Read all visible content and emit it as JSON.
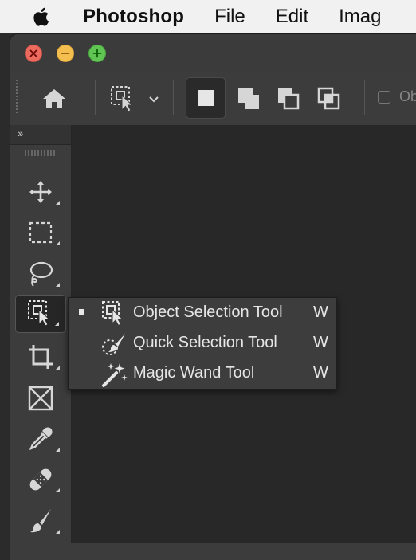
{
  "menubar": {
    "apple": "apple-icon",
    "app_name": "Photoshop",
    "items": [
      "File",
      "Edit",
      "Imag"
    ]
  },
  "window_controls": {
    "close_color": "#ed6a5e",
    "minimize_color": "#f5bf4f",
    "maximize_color": "#61c554"
  },
  "options_bar": {
    "home_icon": "home-icon",
    "tool_preset_icon": "object-selection-icon",
    "selection_modes": [
      "new-selection",
      "add-to-selection",
      "subtract-from-selection",
      "intersect-with-selection"
    ],
    "active_mode": "new-selection",
    "checkbox_label": "Ob"
  },
  "toolbar": {
    "collapse_label": "››",
    "tools": [
      {
        "name": "move-tool",
        "icon": "move-icon"
      },
      {
        "name": "rectangular-marquee-tool",
        "icon": "marquee-icon"
      },
      {
        "name": "lasso-tool",
        "icon": "lasso-icon"
      },
      {
        "name": "object-selection-tool",
        "icon": "object-selection-icon",
        "active": true
      },
      {
        "name": "crop-tool",
        "icon": "crop-icon"
      },
      {
        "name": "frame-tool",
        "icon": "frame-icon"
      },
      {
        "name": "eyedropper-tool",
        "icon": "eyedropper-icon"
      },
      {
        "name": "spot-healing-tool",
        "icon": "bandage-icon"
      },
      {
        "name": "brush-tool",
        "icon": "brush-icon"
      }
    ]
  },
  "flyout": {
    "items": [
      {
        "label": "Object Selection Tool",
        "shortcut": "W",
        "selected": true,
        "icon": "object-selection-icon"
      },
      {
        "label": "Quick Selection Tool",
        "shortcut": "W",
        "selected": false,
        "icon": "quick-selection-icon"
      },
      {
        "label": "Magic Wand Tool",
        "shortcut": "W",
        "selected": false,
        "icon": "magic-wand-icon"
      }
    ]
  },
  "colors": {
    "menubar_bg": "#f1f1f1",
    "panel_bg": "#3c3c3c",
    "canvas_bg": "#282828",
    "icon": "#d6d6d6"
  }
}
